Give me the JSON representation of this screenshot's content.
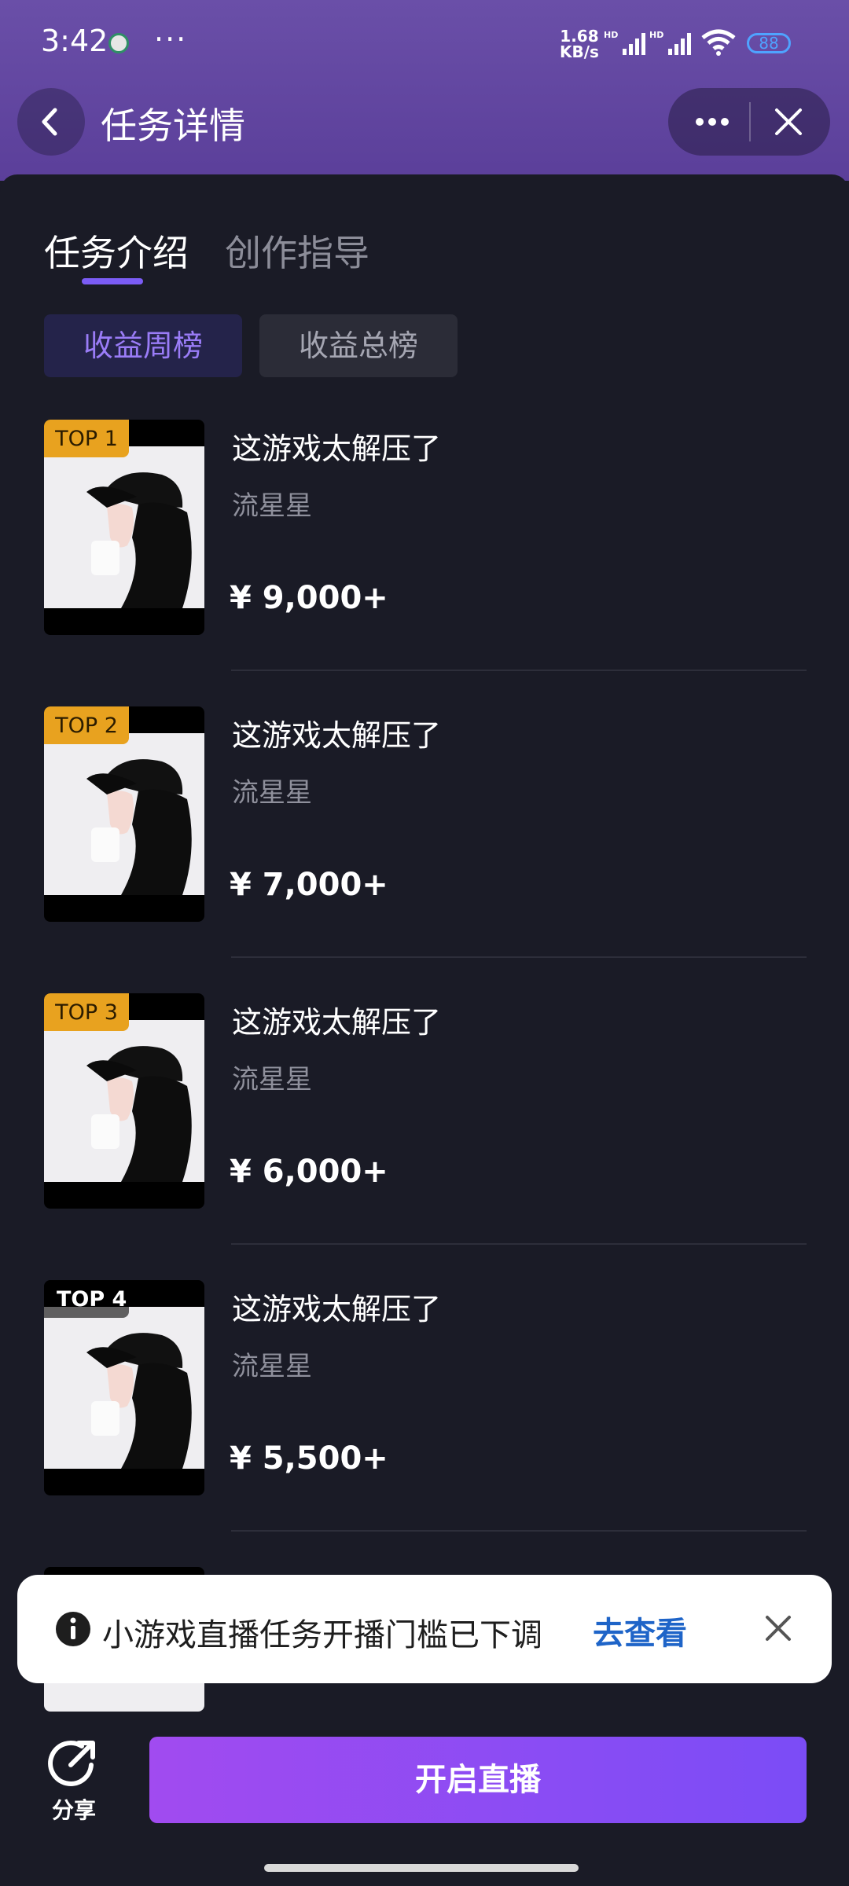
{
  "status_bar": {
    "time": "3:42",
    "more": "···",
    "net_speed_value": "1.68",
    "net_speed_unit": "KB/s",
    "battery": "88"
  },
  "header": {
    "title": "任务详情"
  },
  "tabs": {
    "intro": "任务介绍",
    "guide": "创作指导"
  },
  "filters": {
    "weekly": "收益周榜",
    "total": "收益总榜"
  },
  "items": [
    {
      "badge": "TOP 1",
      "title": "这游戏太解压了",
      "author": "流星星",
      "price": "¥ 9,000+"
    },
    {
      "badge": "TOP 2",
      "title": "这游戏太解压了",
      "author": "流星星",
      "price": "¥ 7,000+"
    },
    {
      "badge": "TOP 3",
      "title": "这游戏太解压了",
      "author": "流星星",
      "price": "¥ 6,000+"
    },
    {
      "badge": "TOP 4",
      "title": "这游戏太解压了",
      "author": "流星星",
      "price": "¥ 5,500+"
    }
  ],
  "toast": {
    "message": "小游戏直播任务开播门槛已下调",
    "link": "去查看"
  },
  "bottom": {
    "share": "分享",
    "start_live": "开启直播"
  },
  "colors": {
    "accent": "#7b5cf5",
    "header": "#6a4fa8",
    "background": "#1a1b26",
    "top_badge": "#e8a21f",
    "link": "#1e64c8"
  }
}
